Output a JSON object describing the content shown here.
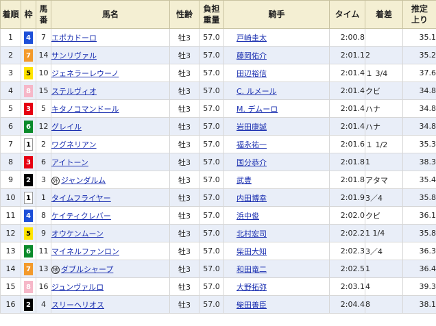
{
  "headers": {
    "rank": "着順",
    "waku": "枠",
    "umaban": "馬番",
    "horse": "馬名",
    "sexage": "性齢",
    "weight": "負担重量",
    "jockey": "騎手",
    "time": "タイム",
    "margin": "着差",
    "agari": "推定上り"
  },
  "colors": {
    "header_bg": "#f4efd3",
    "even_row_bg": "#e9eef8",
    "link": "#1a2fb0",
    "waku": {
      "1": {
        "bg": "#ffffff",
        "fg": "#000000"
      },
      "2": {
        "bg": "#000000",
        "fg": "#ffffff"
      },
      "3": {
        "bg": "#e60012",
        "fg": "#ffffff"
      },
      "4": {
        "bg": "#1d4fd8",
        "fg": "#ffffff"
      },
      "5": {
        "bg": "#ffe400",
        "fg": "#000000"
      },
      "6": {
        "bg": "#0a8a2a",
        "fg": "#ffffff"
      },
      "7": {
        "bg": "#f39a2b",
        "fg": "#ffffff"
      },
      "8": {
        "bg": "#f6b7c8",
        "fg": "#ffffff"
      }
    }
  },
  "rows": [
    {
      "rank": "1",
      "waku": "4",
      "umaban": "7",
      "mark": "",
      "horse": "エポカドーロ",
      "sexage": "牡3",
      "weight": "57.0",
      "jockey": "戸崎圭太",
      "time": "2:00.8",
      "margin": "",
      "agari": "35.1"
    },
    {
      "rank": "2",
      "waku": "7",
      "umaban": "14",
      "mark": "",
      "horse": "サンリヴァル",
      "sexage": "牡3",
      "weight": "57.0",
      "jockey": "藤岡佑介",
      "time": "2:01.1",
      "margin": "2",
      "agari": "35.2"
    },
    {
      "rank": "3",
      "waku": "5",
      "umaban": "10",
      "mark": "",
      "horse": "ジェネラーレウーノ",
      "sexage": "牡3",
      "weight": "57.0",
      "jockey": "田辺裕信",
      "time": "2:01.4",
      "margin": "１ 3/4",
      "agari": "37.6"
    },
    {
      "rank": "4",
      "waku": "8",
      "umaban": "15",
      "mark": "",
      "horse": "ステルヴィオ",
      "sexage": "牡3",
      "weight": "57.0",
      "jockey": "C. ルメール",
      "time": "2:01.4",
      "margin": "クビ",
      "agari": "34.8"
    },
    {
      "rank": "5",
      "waku": "3",
      "umaban": "5",
      "mark": "",
      "horse": "キタノコマンドール",
      "sexage": "牡3",
      "weight": "57.0",
      "jockey": "M. デムーロ",
      "time": "2:01.4",
      "margin": "ハナ",
      "agari": "34.8"
    },
    {
      "rank": "6",
      "waku": "6",
      "umaban": "12",
      "mark": "",
      "horse": "グレイル",
      "sexage": "牡3",
      "weight": "57.0",
      "jockey": "岩田康誠",
      "time": "2:01.4",
      "margin": "ハナ",
      "agari": "34.8"
    },
    {
      "rank": "7",
      "waku": "1",
      "umaban": "2",
      "mark": "",
      "horse": "ワグネリアン",
      "sexage": "牡3",
      "weight": "57.0",
      "jockey": "福永祐一",
      "time": "2:01.6",
      "margin": "１ 1/2",
      "agari": "35.3"
    },
    {
      "rank": "8",
      "waku": "3",
      "umaban": "6",
      "mark": "",
      "horse": "アイトーン",
      "sexage": "牡3",
      "weight": "57.0",
      "jockey": "国分恭介",
      "time": "2:01.8",
      "margin": "1",
      "agari": "38.3"
    },
    {
      "rank": "9",
      "waku": "2",
      "umaban": "3",
      "mark": "外",
      "horse": "ジャンダルム",
      "sexage": "牡3",
      "weight": "57.0",
      "jockey": "武豊",
      "time": "2:01.8",
      "margin": "アタマ",
      "agari": "35.4"
    },
    {
      "rank": "10",
      "waku": "1",
      "umaban": "1",
      "mark": "",
      "horse": "タイムフライヤー",
      "sexage": "牡3",
      "weight": "57.0",
      "jockey": "内田博幸",
      "time": "2:01.9",
      "margin": "3／4",
      "agari": "35.8"
    },
    {
      "rank": "11",
      "waku": "4",
      "umaban": "8",
      "mark": "",
      "horse": "ケイティクレバー",
      "sexage": "牡3",
      "weight": "57.0",
      "jockey": "浜中俊",
      "time": "2:02.0",
      "margin": "クビ",
      "agari": "36.1"
    },
    {
      "rank": "12",
      "waku": "5",
      "umaban": "9",
      "mark": "",
      "horse": "オウケンムーン",
      "sexage": "牡3",
      "weight": "57.0",
      "jockey": "北村宏司",
      "time": "2:02.2",
      "margin": "1 1/4",
      "agari": "35.8"
    },
    {
      "rank": "13",
      "waku": "6",
      "umaban": "11",
      "mark": "",
      "horse": "マイネルファンロン",
      "sexage": "牡3",
      "weight": "57.0",
      "jockey": "柴田大知",
      "time": "2:02.3",
      "margin": "3／4",
      "agari": "36.3"
    },
    {
      "rank": "14",
      "waku": "7",
      "umaban": "13",
      "mark": "地",
      "horse": "ダブルシャープ",
      "sexage": "牡3",
      "weight": "57.0",
      "jockey": "和田竜二",
      "time": "2:02.5",
      "margin": "1",
      "agari": "36.4"
    },
    {
      "rank": "15",
      "waku": "8",
      "umaban": "16",
      "mark": "",
      "horse": "ジュンヴァルロ",
      "sexage": "牡3",
      "weight": "57.0",
      "jockey": "大野拓弥",
      "time": "2:03.1",
      "margin": "4",
      "agari": "39.3"
    },
    {
      "rank": "16",
      "waku": "2",
      "umaban": "4",
      "mark": "",
      "horse": "スリーヘリオス",
      "sexage": "牡3",
      "weight": "57.0",
      "jockey": "柴田善臣",
      "time": "2:04.4",
      "margin": "8",
      "agari": "38.1"
    }
  ]
}
